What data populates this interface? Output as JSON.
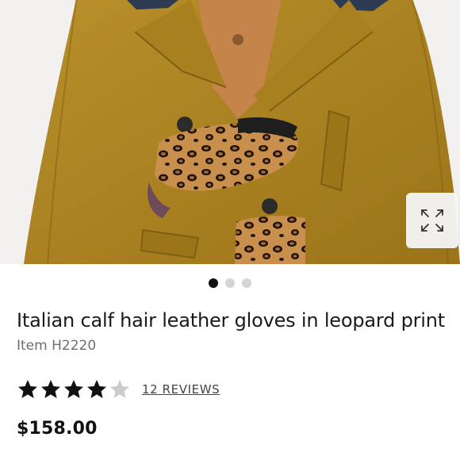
{
  "product": {
    "title": "Italian calf hair leather gloves in leopard print",
    "item_code": "Item H2220",
    "rating": 4,
    "rating_max": 5,
    "reviews_label": "12 REVIEWS",
    "price": "$158.00"
  },
  "gallery": {
    "image_name": "model-in-mustard-coat-with-leopard-gloves",
    "expand_icon": "expand-arrows-icon",
    "dots": [
      {
        "active": true
      },
      {
        "active": false
      },
      {
        "active": false
      }
    ]
  },
  "colors": {
    "coat": "#a8801f",
    "star_filled": "#111111",
    "star_empty": "#cccccc",
    "dot_active": "#111111",
    "dot_inactive": "#d4d4d4"
  }
}
